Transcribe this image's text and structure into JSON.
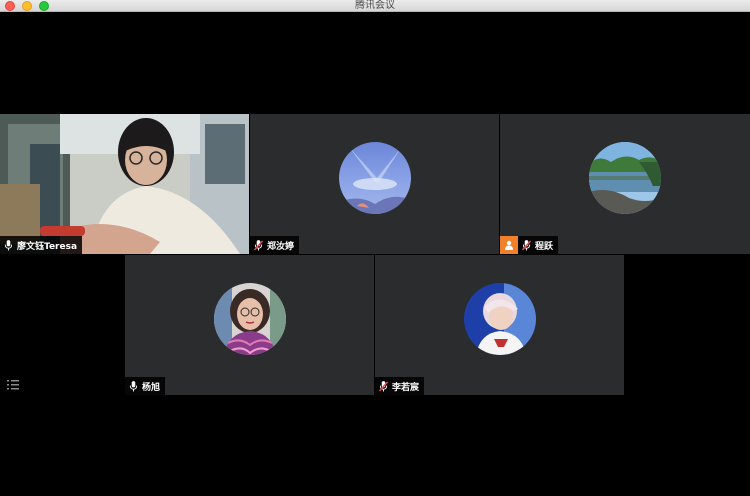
{
  "window": {
    "title": "腾讯会议"
  },
  "participants": [
    {
      "name": "廖文钰Teresa",
      "mic": "on",
      "video": true
    },
    {
      "name": "郑汝婷",
      "mic": "muted"
    },
    {
      "name": "程跃",
      "mic": "muted",
      "badge": "person-icon"
    },
    {
      "name": "杨旭",
      "mic": "on"
    },
    {
      "name": "李若宸",
      "mic": "muted"
    }
  ],
  "colors": {
    "tile_bg": "#2b2c2e",
    "muted_mic": "#e5484d",
    "badge": "#f0802a"
  }
}
